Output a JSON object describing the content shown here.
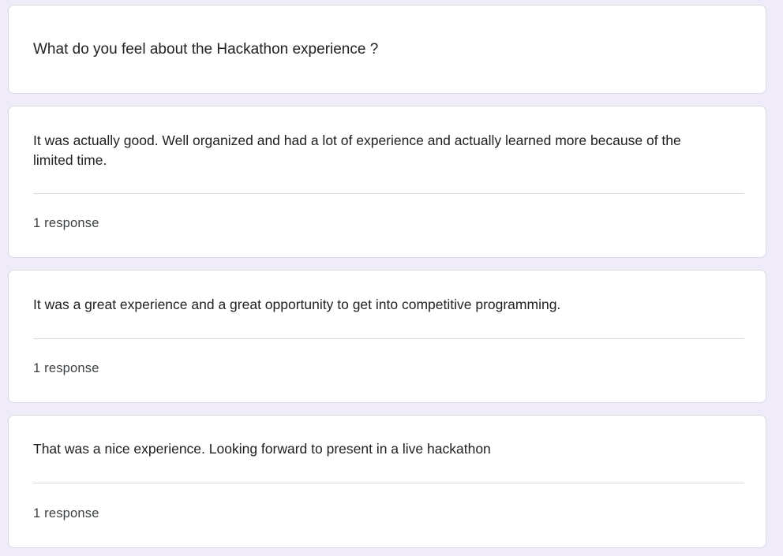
{
  "question": {
    "text": "What do you feel about the Hackathon experience ?"
  },
  "responses": [
    {
      "text": "It was actually good. Well organized and had a lot of experience and actually learned more because of the limited time.",
      "count_label": "1 response"
    },
    {
      "text": "It was a great experience and a great opportunity to get into competitive programming.",
      "count_label": "1 response"
    },
    {
      "text": "That was a nice experience. Looking forward to present in a live hackathon",
      "count_label": "1 response"
    }
  ],
  "colors": {
    "page_background": "#f0ebf8",
    "card_background": "#ffffff",
    "card_border": "#dadce0",
    "text_primary": "#202124",
    "text_secondary": "#3c4043"
  }
}
